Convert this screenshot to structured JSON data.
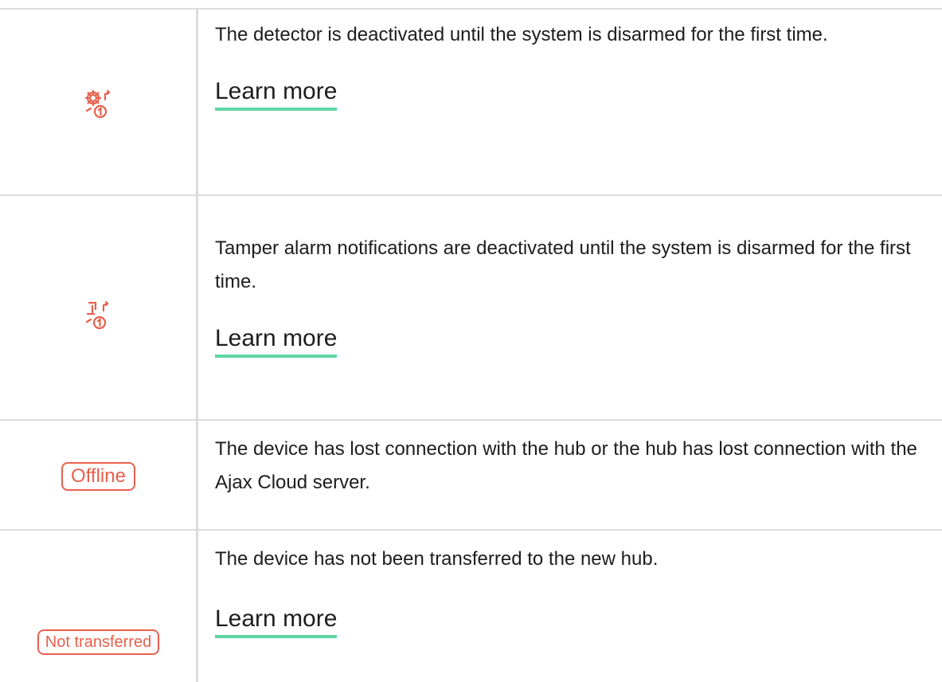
{
  "colors": {
    "accent_red": "#e8604c",
    "link_underline": "#5fd6a4",
    "grid": "#dcdcdc",
    "text": "#1d1d1d"
  },
  "rows": [
    {
      "icon": "gear-first-disarm-icon",
      "description": "The detector is deactivated until the system is disarmed for the first time.",
      "link": "Learn more"
    },
    {
      "icon": "tamper-first-disarm-icon",
      "description": "Tamper alarm notifications are deactivated until the system is disarmed for the first time.",
      "link": "Learn more"
    },
    {
      "badge": "Offline",
      "description": "The device has lost connection with the hub or the hub has lost connection with the Ajax Cloud server."
    },
    {
      "badge": "Not transferred",
      "description": "The device has not been transferred to the new hub.",
      "link": "Learn more"
    }
  ]
}
